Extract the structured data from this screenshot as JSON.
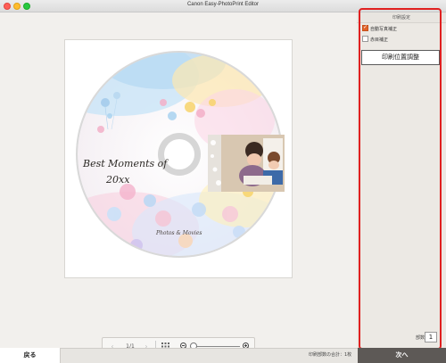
{
  "window": {
    "title": "Canon Easy-PhotoPrint Editor"
  },
  "disc": {
    "title_line1": "Best Moments of",
    "title_line2": "20xx",
    "subtitle": "Photos & Movies"
  },
  "navigation": {
    "prev_icon": "chevron-left-icon",
    "page_indicator": "1/1",
    "next_icon": "chevron-right-icon",
    "grid_icon": "grid-icon",
    "zoom_out_icon": "zoom-out-icon",
    "zoom_in_icon": "zoom-in-icon",
    "zoom_level": 0.0
  },
  "side_panel": {
    "header": "印刷設定",
    "auto_photo_fix": {
      "label": "自動写真補正",
      "checked": true
    },
    "red_eye_fix": {
      "label": "赤目補正",
      "checked": false
    },
    "adjust_button": "印刷位置調整",
    "copies_label": "部数",
    "copies_value": "1"
  },
  "bottom": {
    "back_label": "戻る",
    "total_label": "印刷部数の合計：1枚",
    "next_label": "次へ"
  },
  "colors": {
    "highlight": "#e02020",
    "checkbox_on": "#e0632a",
    "next_button": "#5d5956"
  }
}
